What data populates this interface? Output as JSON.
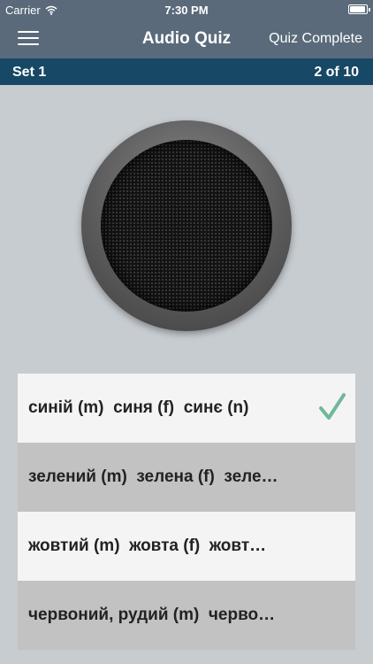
{
  "status_bar": {
    "carrier": "Carrier",
    "time": "7:30 PM",
    "battery_level": 0.95
  },
  "nav": {
    "title": "Audio Quiz",
    "right_button": "Quiz Complete"
  },
  "set_bar": {
    "label": "Set 1",
    "progress": "2 of 10"
  },
  "answers": [
    {
      "text": "синій (m)  синя (f)  синє (n)",
      "correct": true
    },
    {
      "text": "зелений (m)  зелена (f)  зеле…",
      "correct": false
    },
    {
      "text": "жовтий (m)  жовта (f)  жовт…",
      "correct": false
    },
    {
      "text": "червоний, рудий (m)  черво…",
      "correct": false
    }
  ],
  "colors": {
    "nav_bar": "#5a6a7a",
    "set_bar": "#174866",
    "background": "#c7ccd1",
    "check_accent": "#6fb89a"
  }
}
